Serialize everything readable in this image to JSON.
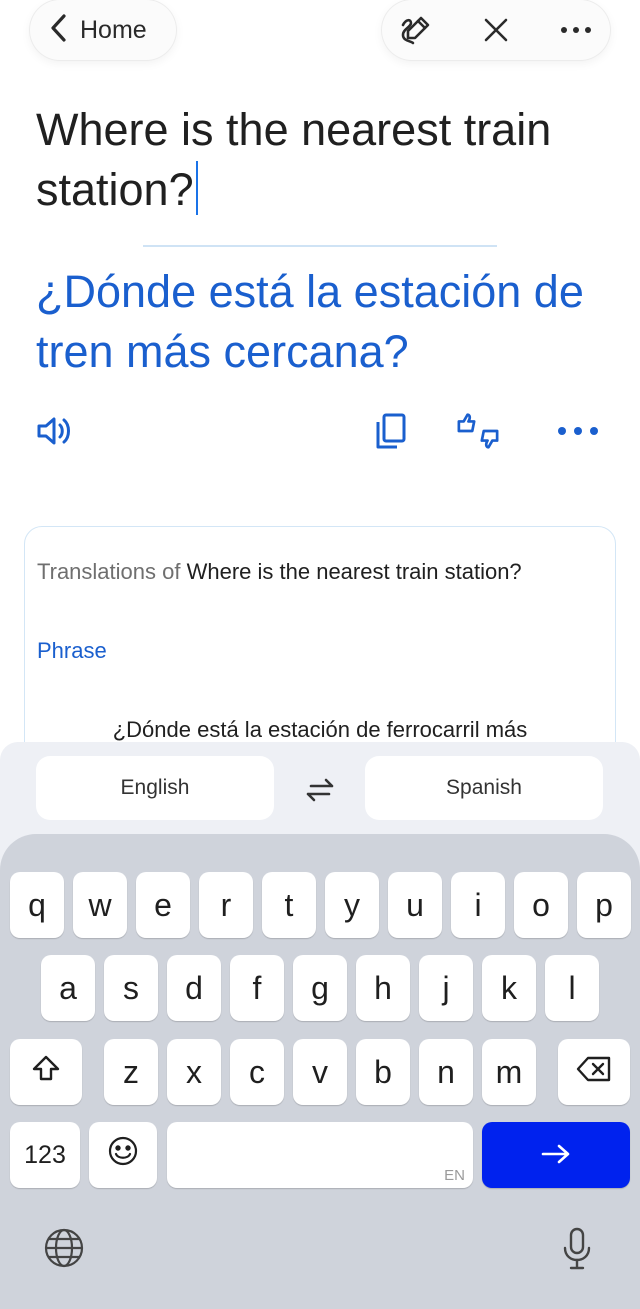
{
  "header": {
    "back_label": "Home",
    "icons": [
      "back-chevron-icon",
      "handwriting-icon",
      "close-icon",
      "more-icon"
    ]
  },
  "source_text": "Where is the nearest train station?",
  "translated_text": "¿Dónde está la estación de tren más cercana?",
  "result_toolbar": {
    "icons": [
      "speaker-icon",
      "copy-icon",
      "rate-icon",
      "more-icon"
    ]
  },
  "card": {
    "prefix": "Translations of",
    "query": "Where is the nearest train station?",
    "category": "Phrase",
    "first_translation": "¿Dónde está la estación de ferrocarril más"
  },
  "languages": {
    "source": "English",
    "target": "Spanish",
    "swap_icon": "swap-icon"
  },
  "keyboard": {
    "row1": [
      "q",
      "w",
      "e",
      "r",
      "t",
      "y",
      "u",
      "i",
      "o",
      "p"
    ],
    "row2": [
      "a",
      "s",
      "d",
      "f",
      "g",
      "h",
      "j",
      "k",
      "l"
    ],
    "row3": [
      "z",
      "x",
      "c",
      "v",
      "b",
      "n",
      "m"
    ],
    "numbers_label": "123",
    "space_hint": "EN",
    "accent_color": "#0022ee",
    "icons": [
      "shift-icon",
      "backspace-icon",
      "emoji-icon",
      "enter-arrow-icon",
      "globe-icon",
      "microphone-icon"
    ]
  }
}
